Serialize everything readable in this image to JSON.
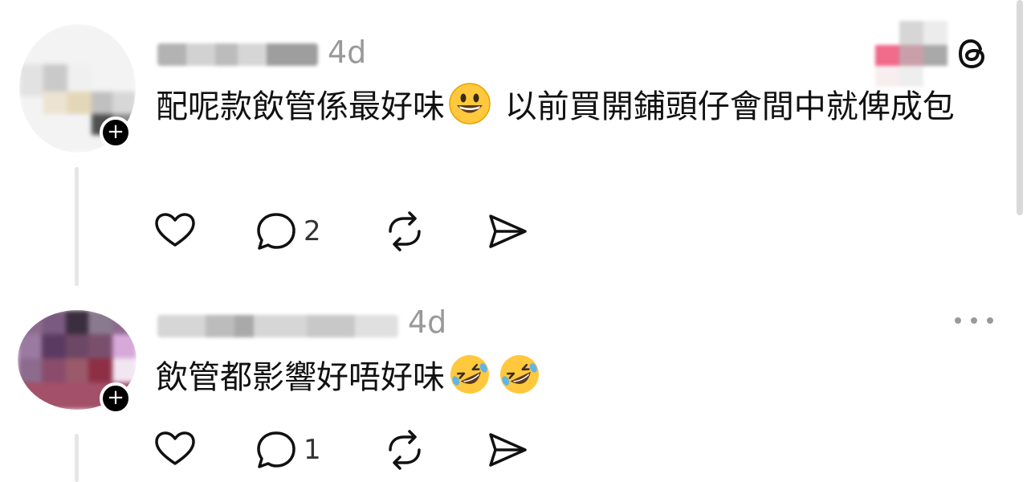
{
  "posts": [
    {
      "time": "4d",
      "text_a": "配呢款飲管係最好味",
      "text_b": " 以前買開鋪頭仔會間中就俾成包",
      "emojis": [
        "grinning-face"
      ],
      "like_label": "Like",
      "reply_count": "2",
      "repost_label": "Repost",
      "share_label": "Share"
    },
    {
      "time": "4d",
      "text_a": "飲管都影響好唔好味",
      "text_b": "",
      "emojis": [
        "rolling-on-floor-laughing",
        "rolling-on-floor-laughing"
      ],
      "like_label": "Like",
      "reply_count": "1",
      "repost_label": "Repost",
      "share_label": "Share"
    }
  ],
  "follow_badge": "+",
  "icons": {
    "logo": "threads-logo-icon",
    "like": "heart-icon",
    "reply": "speech-bubble-icon",
    "repost": "repost-icon",
    "share": "send-icon",
    "more": "more-horizontal-icon"
  },
  "colors": {
    "text": "#111111",
    "muted": "#999999",
    "thread_line": "#e6e6e6",
    "emoji_yellow": "#ffc83d"
  }
}
